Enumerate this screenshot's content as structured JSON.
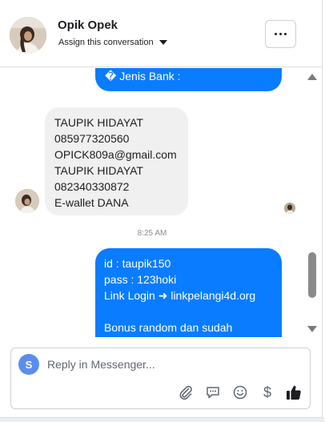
{
  "header": {
    "contact_name": "Opik Opek",
    "assign_label": "Assign this conversation"
  },
  "messages": {
    "partial_outgoing": [
      "� Jenis Bank :"
    ],
    "incoming": [
      "TAUPIK HIDAYAT",
      "085977320560",
      "OPICK809a@gmail.com",
      "TAUPIK HIDAYAT",
      "082340330872",
      "E-wallet DANA"
    ],
    "timestamp": "8:25 AM",
    "outgoing": [
      "id : taupik150",
      "pass : 123hoki",
      "Link Login ➜ linkpelangi4d.org",
      "",
      "Bonus random dan sudah"
    ]
  },
  "composer": {
    "sender_initial": "S",
    "placeholder": "Reply in Messenger..."
  },
  "icons": [
    "more-options-icon",
    "caret-down-icon",
    "attachment-icon",
    "saved-replies-icon",
    "emoji-icon",
    "payment-icon",
    "thumbs-up-icon"
  ],
  "colors": {
    "outgoing_bubble": "#0a7cff",
    "incoming_bubble": "#f0f0f0",
    "sender_avatar": "#5b8def",
    "like_icon": "#1c1e21"
  }
}
